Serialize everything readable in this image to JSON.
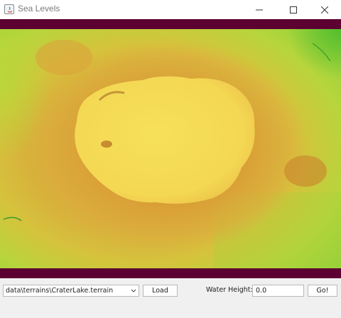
{
  "window": {
    "title": "Sea Levels",
    "icon": "java-app-icon",
    "controls": [
      "minimize-icon",
      "maximize-icon",
      "close-icon"
    ]
  },
  "terrain": {
    "name": "CraterLake",
    "colors": {
      "water_border": "#5b0031",
      "low": "#9fd73c",
      "mid": "#d9a73a",
      "high": "#f5dc55"
    }
  },
  "controls": {
    "terrain_file": "data\\terrains\\CraterLake.terrain",
    "load_label": "Load",
    "water_height_label": "Water Height:",
    "water_height_value": "0.0",
    "go_label": "Go!"
  }
}
